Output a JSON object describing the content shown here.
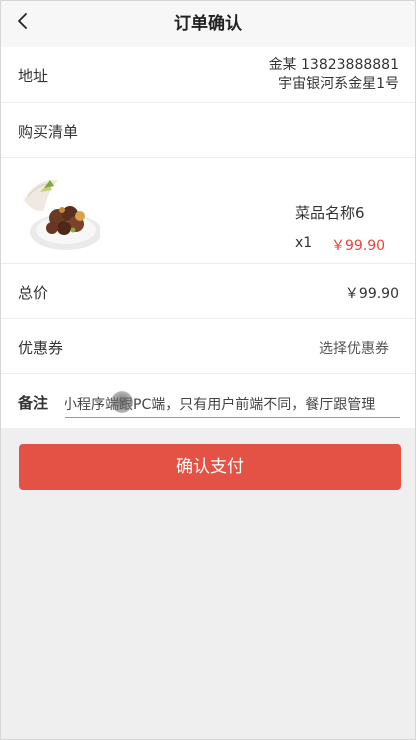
{
  "header": {
    "title": "订单确认",
    "back_icon": "chevron-left-icon"
  },
  "address": {
    "label": "地址",
    "name_phone": "金某 13823888881",
    "detail": "宇宙银河系金星1号"
  },
  "purchase_list": {
    "label": "购买清单"
  },
  "item": {
    "name": "菜品名称6",
    "quantity": "x1",
    "price": "￥99.90",
    "image": "dish-thumbnail"
  },
  "total": {
    "label": "总价",
    "value": "￥99.90"
  },
  "coupon": {
    "label": "优惠券",
    "action": "选择优惠券"
  },
  "remark": {
    "label": "备注",
    "value": "小程序端跟PC端，只有用户前端不同，餐厅跟管理"
  },
  "pay_button": {
    "label": "确认支付"
  },
  "colors": {
    "accent": "#e45145",
    "price": "#e8413c",
    "background": "#efefef"
  }
}
